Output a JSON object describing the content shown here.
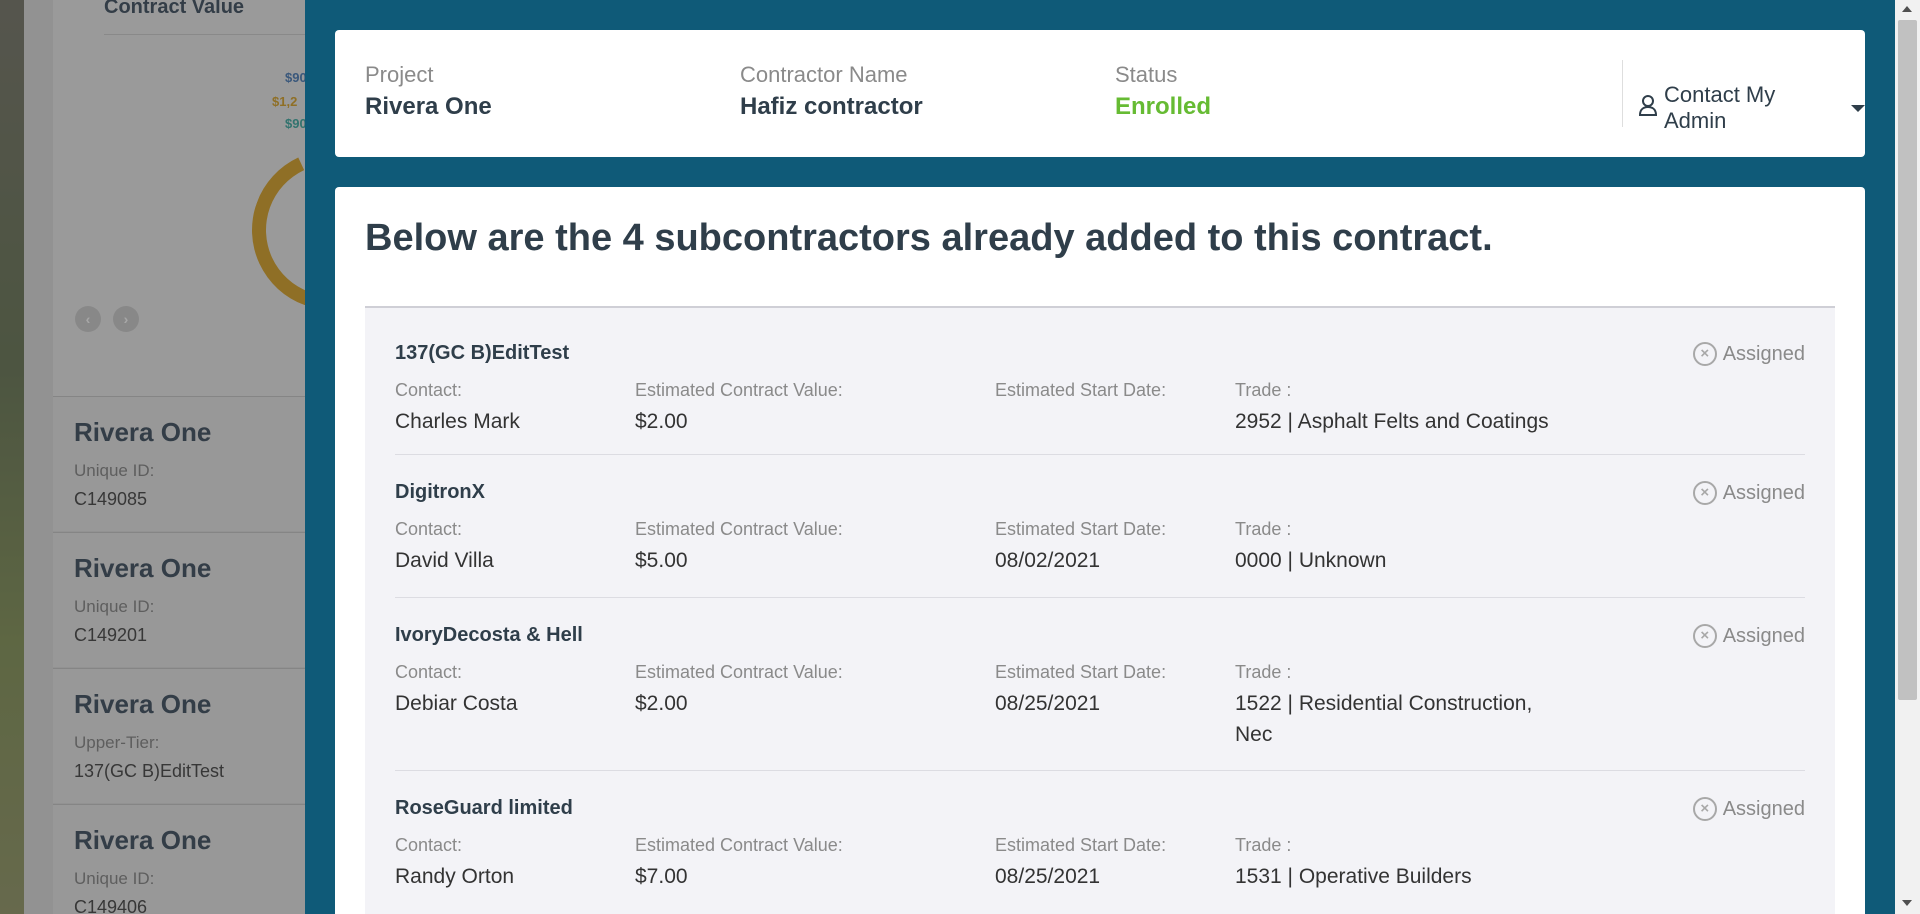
{
  "background": {
    "chart_title": "Contract Value",
    "legend": [
      {
        "text": "$90",
        "color": "#3a6fb0"
      },
      {
        "text": "$1,2",
        "color": "#d39a14"
      },
      {
        "text": "$90",
        "color": "#2aa198"
      }
    ],
    "cards": [
      {
        "title": "Rivera One",
        "label": "Unique ID:",
        "value": "C149085"
      },
      {
        "title": "Rivera One",
        "label": "Unique ID:",
        "value": "C149201"
      },
      {
        "title": "Rivera One",
        "label": "Upper-Tier:",
        "value": "137(GC B)EditTest"
      },
      {
        "title": "Rivera One",
        "label": "Unique ID:",
        "value": "C149406"
      }
    ]
  },
  "header": {
    "project_label": "Project",
    "project_value": "Rivera One",
    "contractor_label": "Contractor Name",
    "contractor_value": "Hafiz contractor",
    "status_label": "Status",
    "status_value": "Enrolled",
    "contact_admin": "Contact My Admin"
  },
  "main": {
    "heading": "Below are the 4 subcontractors already added to this contract.",
    "subcontractors": [
      {
        "name": "137(GC B)EditTest",
        "contact_label": "Contact:",
        "contact": "Charles Mark",
        "value_label": "Estimated Contract Value:",
        "value": "$2.00",
        "start_label": "Estimated Start Date:",
        "start": "",
        "trade_label": "Trade :",
        "trade": "2952 | Asphalt Felts and Coatings",
        "status": "Assigned"
      },
      {
        "name": "DigitronX",
        "contact_label": "Contact:",
        "contact": "David Villa",
        "value_label": "Estimated Contract Value:",
        "value": "$5.00",
        "start_label": "Estimated Start Date:",
        "start": "08/02/2021",
        "trade_label": "Trade :",
        "trade": "0000 | Unknown",
        "status": "Assigned"
      },
      {
        "name": "IvoryDecosta & Hell",
        "contact_label": "Contact:",
        "contact": "Debiar Costa",
        "value_label": "Estimated Contract Value:",
        "value": "$2.00",
        "start_label": "Estimated Start Date:",
        "start": "08/25/2021",
        "trade_label": "Trade :",
        "trade": "1522 | Residential Construction, Nec",
        "status": "Assigned"
      },
      {
        "name": "RoseGuard limited",
        "contact_label": "Contact:",
        "contact": "Randy Orton",
        "value_label": "Estimated Contract Value:",
        "value": "$7.00",
        "start_label": "Estimated Start Date:",
        "start": "08/25/2021",
        "trade_label": "Trade :",
        "trade": "1531 | Operative Builders",
        "status": "Assigned"
      }
    ]
  },
  "icons": {
    "user": "user-icon",
    "caret": "caret-down-icon",
    "remove": "close-circle-icon"
  }
}
